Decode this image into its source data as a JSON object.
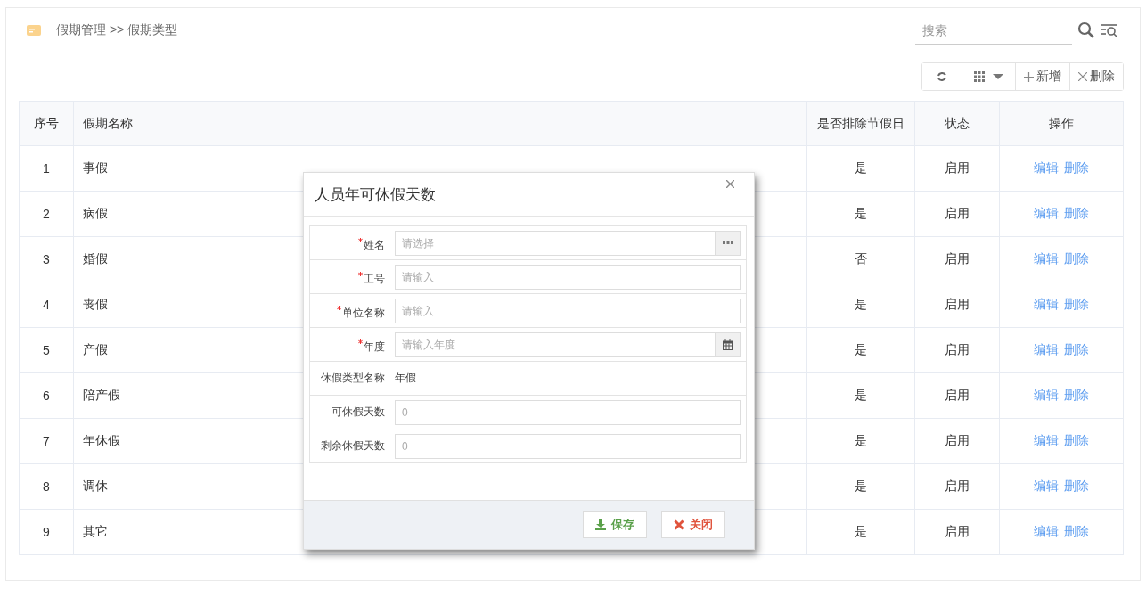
{
  "breadcrumb": {
    "text": "假期管理 >> 假期类型"
  },
  "search": {
    "placeholder": "搜索"
  },
  "toolbar": {
    "buttons": [
      {
        "kind": "refresh"
      },
      {
        "kind": "columns"
      },
      {
        "kind": "add",
        "label": "新增"
      },
      {
        "kind": "delete",
        "label": "删除"
      }
    ]
  },
  "table": {
    "columns": [
      "序号",
      "假期名称",
      "是否排除节假日",
      "状态",
      "操作"
    ],
    "rows": [
      {
        "index": "1",
        "name": "事假",
        "exclude_holidays": "是",
        "status": "启用",
        "actions": [
          "编辑",
          "删除"
        ]
      },
      {
        "index": "2",
        "name": "病假",
        "exclude_holidays": "是",
        "status": "启用",
        "actions": [
          "编辑",
          "删除"
        ]
      },
      {
        "index": "3",
        "name": "婚假",
        "exclude_holidays": "否",
        "status": "启用",
        "actions": [
          "编辑",
          "删除"
        ]
      },
      {
        "index": "4",
        "name": "丧假",
        "exclude_holidays": "是",
        "status": "启用",
        "actions": [
          "编辑",
          "删除"
        ]
      },
      {
        "index": "5",
        "name": "产假",
        "exclude_holidays": "是",
        "status": "启用",
        "actions": [
          "编辑",
          "删除"
        ]
      },
      {
        "index": "6",
        "name": "陪产假",
        "exclude_holidays": "是",
        "status": "启用",
        "actions": [
          "编辑",
          "删除"
        ]
      },
      {
        "index": "7",
        "name": "年休假",
        "exclude_holidays": "是",
        "status": "启用",
        "actions": [
          "编辑",
          "删除"
        ]
      },
      {
        "index": "8",
        "name": "调休",
        "exclude_holidays": "是",
        "status": "启用",
        "actions": [
          "编辑",
          "删除"
        ]
      },
      {
        "index": "9",
        "name": "其它",
        "exclude_holidays": "是",
        "status": "启用",
        "actions": [
          "编辑",
          "删除"
        ]
      }
    ]
  },
  "dialog": {
    "title": "人员年可休假天数",
    "fields": [
      {
        "label": "姓名",
        "required": true,
        "kind": "picker",
        "placeholder": "请选择"
      },
      {
        "label": "工号",
        "required": true,
        "kind": "text",
        "placeholder": "请输入"
      },
      {
        "label": "单位名称",
        "required": true,
        "kind": "text",
        "placeholder": "请输入"
      },
      {
        "label": "年度",
        "required": true,
        "kind": "date",
        "placeholder": "请输入年度"
      },
      {
        "label": "休假类型名称",
        "required": false,
        "kind": "static",
        "value": "年假"
      },
      {
        "label": "可休假天数",
        "required": false,
        "kind": "text",
        "placeholder": "0"
      },
      {
        "label": "剩余休假天数",
        "required": false,
        "kind": "text",
        "placeholder": "0"
      }
    ],
    "buttons": [
      {
        "kind": "save",
        "label": "保存"
      },
      {
        "kind": "close",
        "label": "关闭"
      }
    ]
  }
}
